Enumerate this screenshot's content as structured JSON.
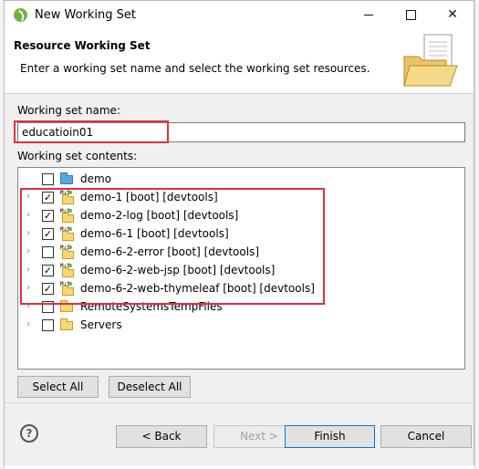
{
  "window": {
    "title": "New Working Set",
    "controls": {
      "minimize": "minimize",
      "maximize": "maximize",
      "close": "✕"
    }
  },
  "header": {
    "title": "Resource Working Set",
    "description": "Enter a working set name and select the working set resources."
  },
  "form": {
    "name_label": "Working set name:",
    "name_value": "educatioin01",
    "contents_label": "Working set contents:"
  },
  "tree": {
    "items": [
      {
        "label": "demo",
        "checked": false,
        "expandable": false,
        "icon": "folder-icon"
      },
      {
        "label": "demo-1 [boot] [devtools]",
        "checked": true,
        "expandable": true,
        "icon": "spring-project-icon"
      },
      {
        "label": "demo-2-log [boot] [devtools]",
        "checked": true,
        "expandable": true,
        "icon": "spring-project-icon"
      },
      {
        "label": "demo-6-1 [boot] [devtools]",
        "checked": true,
        "expandable": true,
        "icon": "spring-project-icon"
      },
      {
        "label": "demo-6-2-error [boot] [devtools]",
        "checked": false,
        "expandable": true,
        "icon": "spring-project-icon"
      },
      {
        "label": "demo-6-2-web-jsp [boot] [devtools]",
        "checked": true,
        "expandable": true,
        "icon": "spring-project-icon"
      },
      {
        "label": "demo-6-2-web-thymeleaf [boot] [devtools]",
        "checked": true,
        "expandable": true,
        "icon": "spring-project-icon"
      },
      {
        "label": "RemoteSystemsTempFiles",
        "checked": false,
        "expandable": true,
        "icon": "folder-icon"
      },
      {
        "label": "Servers",
        "checked": false,
        "expandable": true,
        "icon": "folder-icon"
      }
    ]
  },
  "buttons": {
    "select_all": "Select All",
    "deselect_all": "Deselect All",
    "back": "< Back",
    "next": "Next >",
    "finish": "Finish",
    "cancel": "Cancel",
    "help": "?"
  },
  "colors": {
    "highlight_box": "#e2313b",
    "spring_green": "#6db33f",
    "default_button_border": "#0078d7"
  }
}
